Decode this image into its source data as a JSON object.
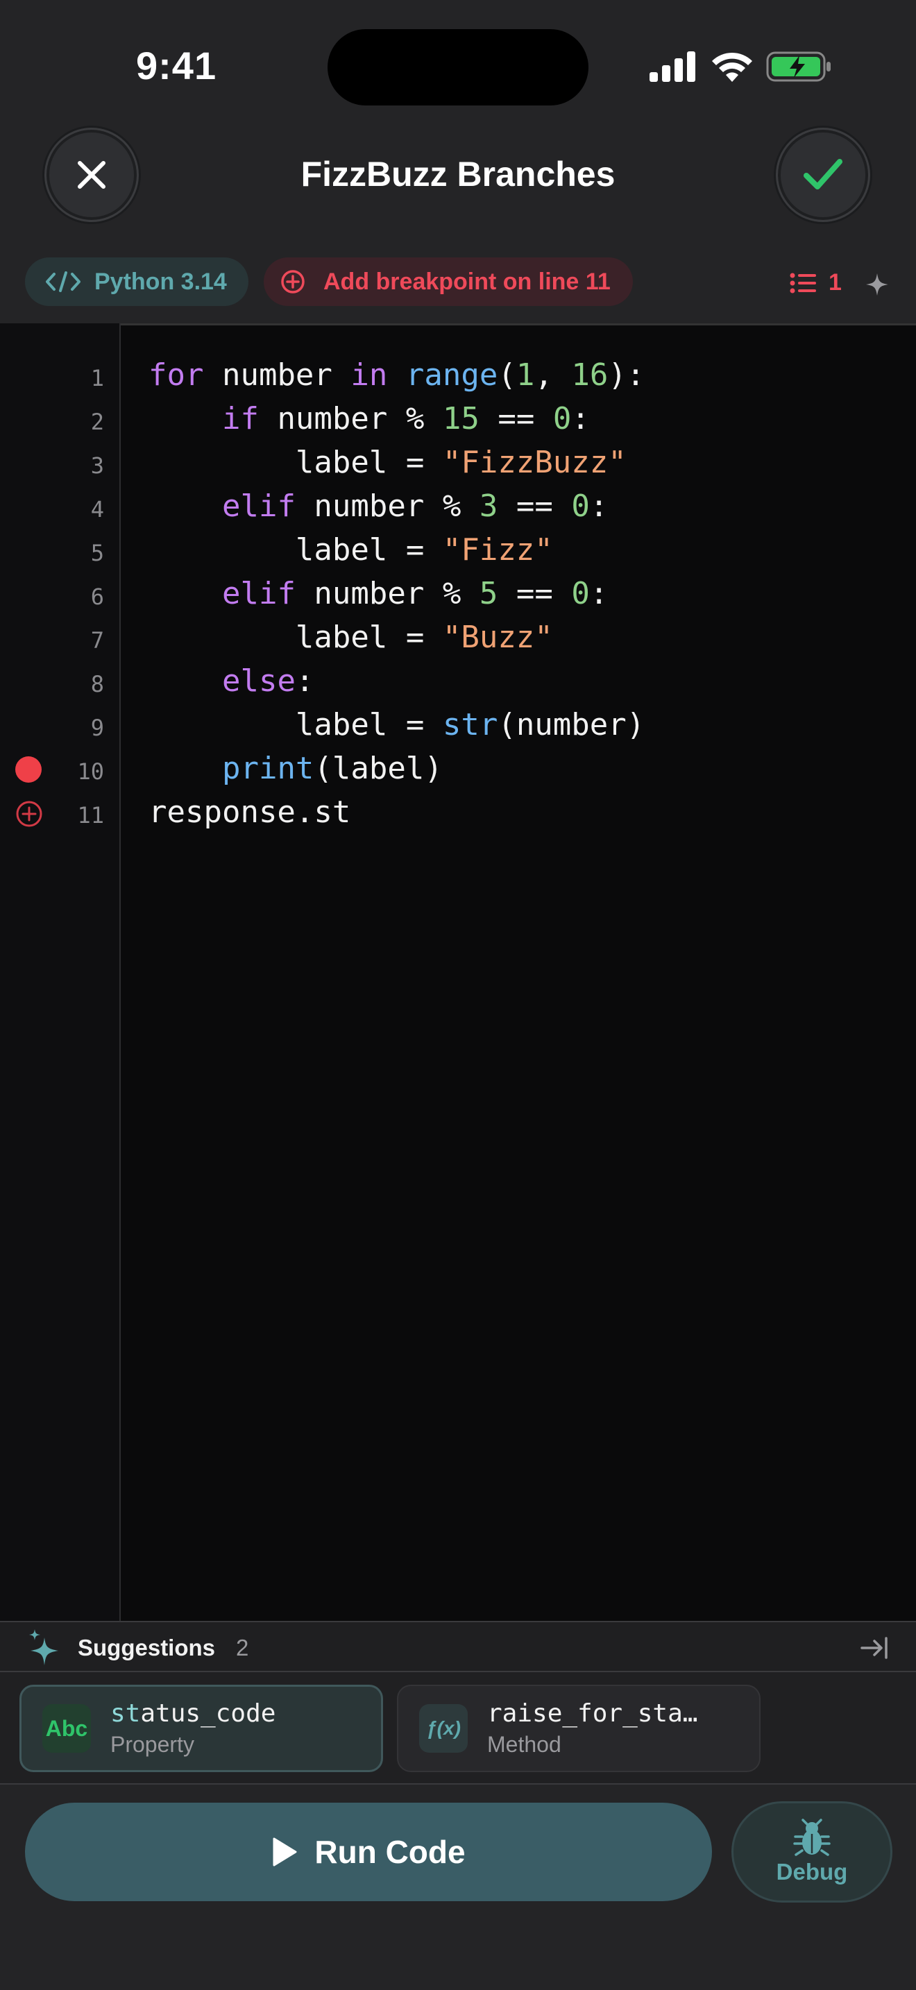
{
  "status_bar": {
    "time": "9:41"
  },
  "header": {
    "title": "FizzBuzz Branches",
    "close_icon": "close-icon",
    "confirm_icon": "checkmark-icon"
  },
  "toolbar": {
    "language_label": "Python 3.14",
    "breakpoint_action": "Add breakpoint on line 11",
    "breakpoint_count": "1"
  },
  "editor": {
    "line_numbers": [
      "1",
      "2",
      "3",
      "4",
      "5",
      "6",
      "7",
      "8",
      "9",
      "10",
      "11"
    ],
    "breakpoint_line": 10,
    "lines": [
      "for number in range(1, 16):",
      "    if number % 15 == 0:",
      "        label = \"FizzBuzz\"",
      "    elif number % 3 == 0:",
      "        label = \"Fizz\"",
      "    elif number % 5 == 0:",
      "        label = \"Buzz\"",
      "    else:",
      "        label = str(number)",
      "    print(label)",
      "response.st"
    ]
  },
  "suggestions": {
    "title": "Suggestions",
    "count": "2",
    "items": [
      {
        "badge": "Abc",
        "name_match": "st",
        "name_rest": "atus_code",
        "kind": "Property"
      },
      {
        "badge": "ƒ(x)",
        "name_match": "",
        "name_rest": "raise_for_sta…",
        "kind": "Method"
      }
    ]
  },
  "actions": {
    "run_label": "Run Code",
    "debug_label": "Debug"
  },
  "colors": {
    "accent": "#5fa9ad",
    "breakpoint": "#ef4a5a",
    "success": "#2fc46a",
    "run_button": "#3a5d66"
  }
}
